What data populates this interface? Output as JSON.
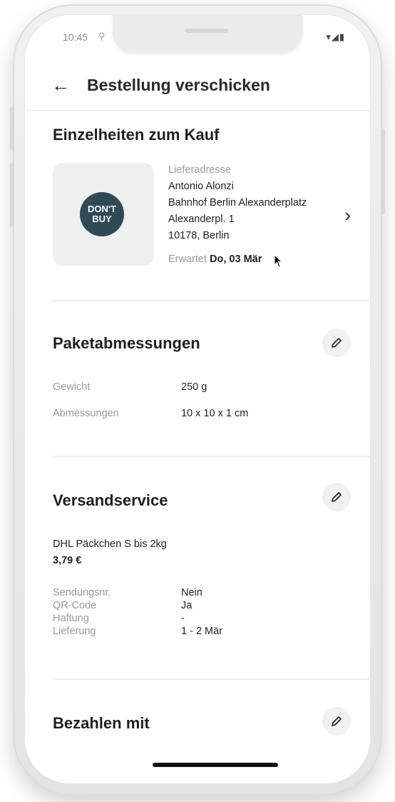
{
  "status_bar": {
    "time": "10:45",
    "location_glyph": "⚲",
    "right_glyphs": "▾◢▮"
  },
  "header": {
    "back_icon": "←",
    "title": "Bestellung verschicken"
  },
  "purchase": {
    "section_title": "Einzelheiten zum Kauf",
    "product_badge_line1": "DON'T",
    "product_badge_line2": "BUY",
    "address_label": "Lieferadresse",
    "name": "Antonio Alonzi",
    "station": "Bahnhof Berlin Alexanderplatz",
    "street": "Alexanderpl. 1",
    "city": "10178, Berlin",
    "expected_label": "Erwartet",
    "expected_date": "Do, 03 Mär",
    "chevron": "›"
  },
  "package": {
    "section_title": "Paketabmessungen",
    "rows": [
      {
        "label": "Gewicht",
        "value": "250 g"
      },
      {
        "label": "Abmessungen",
        "value": "10 x 10 x 1 cm"
      }
    ]
  },
  "shipping": {
    "section_title": "Versandservice",
    "service_name": "DHL Päckchen S bis 2kg",
    "price": "3,79 €",
    "rows": [
      {
        "label": "Sendungsnr.",
        "value": "Nein"
      },
      {
        "label": "QR-Code",
        "value": "Ja"
      },
      {
        "label": "Haftung",
        "value": "-"
      },
      {
        "label": "Lieferung",
        "value": "1 - 2 Mär"
      }
    ]
  },
  "payment": {
    "section_title": "Bezahlen mit"
  },
  "colors": {
    "badge": "#2f4a57",
    "thumb_bg": "#eeefef",
    "text": "#222222",
    "muted": "#9a9a9a"
  },
  "icons": {
    "back": "arrow-left-icon",
    "edit": "pencil-icon",
    "chevron": "chevron-right-icon"
  }
}
